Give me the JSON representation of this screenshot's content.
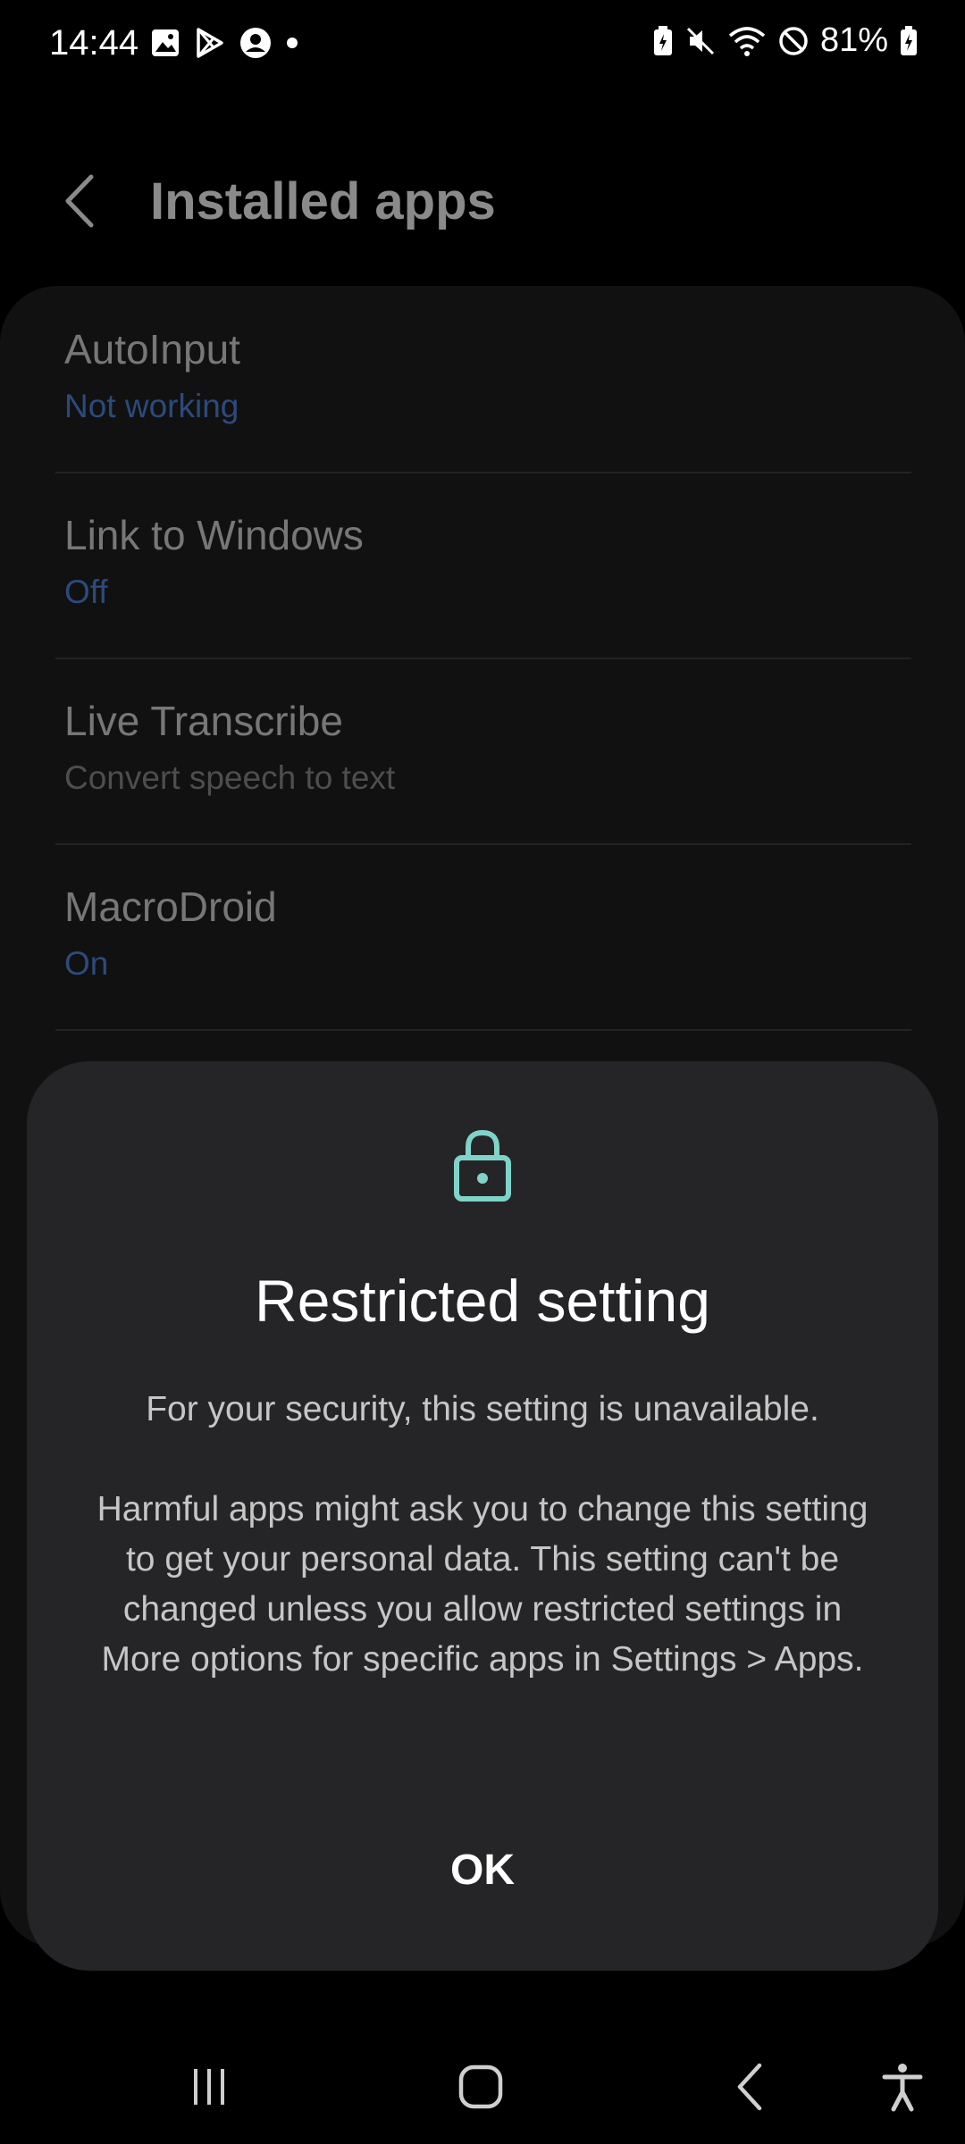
{
  "status_bar": {
    "time": "14:44",
    "battery": "81%",
    "left_icons": [
      "gallery-icon",
      "play-store-icon",
      "account-icon",
      "dot-icon"
    ],
    "right_icons": [
      "battery-saver-icon",
      "mute-icon",
      "wifi-icon",
      "do-not-disturb-icon",
      "battery-icon"
    ]
  },
  "header": {
    "title": "Installed apps"
  },
  "apps": [
    {
      "name": "AutoInput",
      "status": "Not working",
      "status_style": "blue"
    },
    {
      "name": "Link to Windows",
      "status": "Off",
      "status_style": "blue"
    },
    {
      "name": "Live Transcribe",
      "status": "Convert speech to text",
      "status_style": "gray"
    },
    {
      "name": "MacroDroid",
      "status": "On",
      "status_style": "blue"
    }
  ],
  "dialog": {
    "icon": "lock-icon",
    "title": "Restricted setting",
    "body_1": "For your security, this setting is unavailable.",
    "body_2": "Harmful apps might ask you to change this setting to get your personal data. This setting can't be changed unless you allow restricted settings in More options for specific apps in Settings > Apps.",
    "ok_label": "OK",
    "accent_color": "#7fd3c9"
  },
  "nav_bar": {
    "icons": [
      "recents-icon",
      "home-icon",
      "back-icon",
      "accessibility-icon"
    ]
  }
}
